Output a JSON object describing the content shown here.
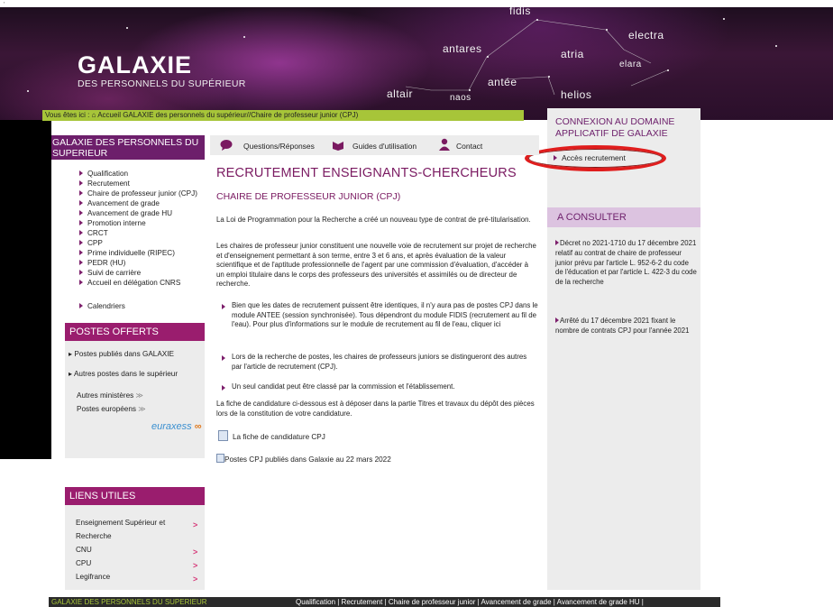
{
  "header": {
    "title": "GALAXIE",
    "subtitle": "DES PERSONNELS DU SUPÉRIEUR",
    "constellations": {
      "fidis": "fidis",
      "electra": "electra",
      "antares": "antares",
      "atria": "atria",
      "elara": "elara",
      "antee": "antée",
      "altair": "altair",
      "naos": "naos",
      "helios": "helios"
    }
  },
  "breadcrumb": "Vous êtes ici : ⌂ Accueil GALAXIE des personnels du supérieur//Chaire de professeur junior (CPJ)",
  "left_nav": {
    "heading": "GALAXIE DES PERSONNELS DU SUPERIEUR",
    "items": [
      "Qualification",
      "Recrutement",
      "Chaire de professeur junior (CPJ)",
      "Avancement de grade",
      "Avancement de grade HU",
      "Promotion interne",
      "CRCT",
      "CPP",
      "Prime individuelle (RIPEC)",
      "PEDR (HU)",
      "Suivi de carrière",
      "Accueil en délégation CNRS"
    ],
    "calendriers": "Calendriers"
  },
  "postes": {
    "heading": "POSTES OFFERTS",
    "item1": "Postes publiés dans GALAXIE",
    "item2": "Autres postes dans le supérieur",
    "item3": "Autres ministères",
    "item4": "Postes européens",
    "euraxess": "euraxess"
  },
  "liens": {
    "heading": "LIENS UTILES",
    "items": [
      "Enseignement Supérieur et",
      "Recherche",
      "CNU",
      "CPU",
      "Legifrance"
    ]
  },
  "toolbar": {
    "questions": "Questions/Réponses",
    "guides": "Guides d'utilisation",
    "contact": "Contact"
  },
  "main": {
    "title": "RECRUTEMENT ENSEIGNANTS-CHERCHEURS",
    "subtitle": "CHAIRE DE PROFESSEUR JUNIOR (CPJ)",
    "para1": "La Loi de Programmation pour la Recherche a créé un nouveau type de contrat de pré-titularisation.",
    "para2": "Les chaires de professeur junior constituent une nouvelle voie de recrutement sur projet de recherche et d'enseignement permettant à son terme, entre 3 et 6 ans, et après évaluation de la valeur scientifique et de l'aptitude professionnelle de l'agent par une commission d'évaluation, d'accéder à un emploi titulaire dans le corps des professeurs des universités et assimilés ou de directeur de recherche.",
    "bullet1": "Bien que les dates de recrutement puissent être identiques, il n'y aura pas de postes CPJ dans le module ANTEE (session synchronisée). Tous dépendront du module FIDIS (recrutement au fil de l'eau). Pour plus d'informations sur le module de recrutement au fil de l'eau, cliquer ici",
    "bullet2": "Lors de la recherche de postes, les chaires de professeurs juniors se distingueront des autres par l'article de recrutement (CPJ).",
    "bullet3": "Un seul candidat peut être classé par la commission et l'établissement.",
    "para3": "La fiche de candidature ci-dessous est à déposer dans la partie Titres et travaux du dépôt des pièces lors de la constitution de votre candidature.",
    "file1": "La fiche de candidature CPJ",
    "file2": "Postes CPJ publiés dans Galaxie au 22 mars 2022"
  },
  "right": {
    "connexion_title": "CONNEXION AU DOMAINE APPLICATIF DE GALAXIE",
    "acces": "Accès recrutement",
    "consult_title": "A CONSULTER",
    "note1": "Décret no 2021-1710 du 17 décembre 2021 relatif au contrat de chaire de professeur junior prévu par l'article L. 952-6-2 du code de l'éducation et par l'article L. 422-3 du code de la recherche",
    "note2": "Arrêté du 17 décembre 2021 fixant le nombre de contrats CPJ pour l'année 2021"
  },
  "footer": {
    "left": "GALAXIE DES PERSONNELS DU SUPERIEUR",
    "right": "Qualification | Recrutement | Chaire de professeur junior | Avancement de grade | Avancement de grade HU |"
  },
  "colors": {
    "brand_purple": "#6d1f6b",
    "accent_magenta": "#9a1d6e",
    "breadcrumb_green": "#a7c539",
    "highlight_red": "#e01d1d"
  }
}
